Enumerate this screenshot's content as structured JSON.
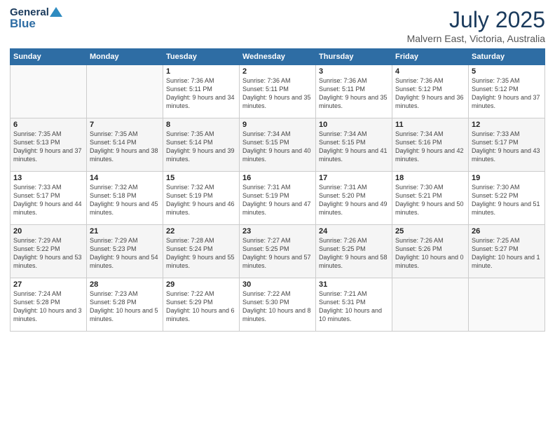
{
  "header": {
    "logo_general": "General",
    "logo_blue": "Blue",
    "month_year": "July 2025",
    "location": "Malvern East, Victoria, Australia"
  },
  "days_of_week": [
    "Sunday",
    "Monday",
    "Tuesday",
    "Wednesday",
    "Thursday",
    "Friday",
    "Saturday"
  ],
  "weeks": [
    [
      {
        "day": "",
        "empty": true
      },
      {
        "day": "",
        "empty": true
      },
      {
        "day": "1",
        "sunrise": "Sunrise: 7:36 AM",
        "sunset": "Sunset: 5:11 PM",
        "daylight": "Daylight: 9 hours and 34 minutes."
      },
      {
        "day": "2",
        "sunrise": "Sunrise: 7:36 AM",
        "sunset": "Sunset: 5:11 PM",
        "daylight": "Daylight: 9 hours and 35 minutes."
      },
      {
        "day": "3",
        "sunrise": "Sunrise: 7:36 AM",
        "sunset": "Sunset: 5:11 PM",
        "daylight": "Daylight: 9 hours and 35 minutes."
      },
      {
        "day": "4",
        "sunrise": "Sunrise: 7:36 AM",
        "sunset": "Sunset: 5:12 PM",
        "daylight": "Daylight: 9 hours and 36 minutes."
      },
      {
        "day": "5",
        "sunrise": "Sunrise: 7:35 AM",
        "sunset": "Sunset: 5:12 PM",
        "daylight": "Daylight: 9 hours and 37 minutes."
      }
    ],
    [
      {
        "day": "6",
        "sunrise": "Sunrise: 7:35 AM",
        "sunset": "Sunset: 5:13 PM",
        "daylight": "Daylight: 9 hours and 37 minutes."
      },
      {
        "day": "7",
        "sunrise": "Sunrise: 7:35 AM",
        "sunset": "Sunset: 5:14 PM",
        "daylight": "Daylight: 9 hours and 38 minutes."
      },
      {
        "day": "8",
        "sunrise": "Sunrise: 7:35 AM",
        "sunset": "Sunset: 5:14 PM",
        "daylight": "Daylight: 9 hours and 39 minutes."
      },
      {
        "day": "9",
        "sunrise": "Sunrise: 7:34 AM",
        "sunset": "Sunset: 5:15 PM",
        "daylight": "Daylight: 9 hours and 40 minutes."
      },
      {
        "day": "10",
        "sunrise": "Sunrise: 7:34 AM",
        "sunset": "Sunset: 5:15 PM",
        "daylight": "Daylight: 9 hours and 41 minutes."
      },
      {
        "day": "11",
        "sunrise": "Sunrise: 7:34 AM",
        "sunset": "Sunset: 5:16 PM",
        "daylight": "Daylight: 9 hours and 42 minutes."
      },
      {
        "day": "12",
        "sunrise": "Sunrise: 7:33 AM",
        "sunset": "Sunset: 5:17 PM",
        "daylight": "Daylight: 9 hours and 43 minutes."
      }
    ],
    [
      {
        "day": "13",
        "sunrise": "Sunrise: 7:33 AM",
        "sunset": "Sunset: 5:17 PM",
        "daylight": "Daylight: 9 hours and 44 minutes."
      },
      {
        "day": "14",
        "sunrise": "Sunrise: 7:32 AM",
        "sunset": "Sunset: 5:18 PM",
        "daylight": "Daylight: 9 hours and 45 minutes."
      },
      {
        "day": "15",
        "sunrise": "Sunrise: 7:32 AM",
        "sunset": "Sunset: 5:19 PM",
        "daylight": "Daylight: 9 hours and 46 minutes."
      },
      {
        "day": "16",
        "sunrise": "Sunrise: 7:31 AM",
        "sunset": "Sunset: 5:19 PM",
        "daylight": "Daylight: 9 hours and 47 minutes."
      },
      {
        "day": "17",
        "sunrise": "Sunrise: 7:31 AM",
        "sunset": "Sunset: 5:20 PM",
        "daylight": "Daylight: 9 hours and 49 minutes."
      },
      {
        "day": "18",
        "sunrise": "Sunrise: 7:30 AM",
        "sunset": "Sunset: 5:21 PM",
        "daylight": "Daylight: 9 hours and 50 minutes."
      },
      {
        "day": "19",
        "sunrise": "Sunrise: 7:30 AM",
        "sunset": "Sunset: 5:22 PM",
        "daylight": "Daylight: 9 hours and 51 minutes."
      }
    ],
    [
      {
        "day": "20",
        "sunrise": "Sunrise: 7:29 AM",
        "sunset": "Sunset: 5:22 PM",
        "daylight": "Daylight: 9 hours and 53 minutes."
      },
      {
        "day": "21",
        "sunrise": "Sunrise: 7:29 AM",
        "sunset": "Sunset: 5:23 PM",
        "daylight": "Daylight: 9 hours and 54 minutes."
      },
      {
        "day": "22",
        "sunrise": "Sunrise: 7:28 AM",
        "sunset": "Sunset: 5:24 PM",
        "daylight": "Daylight: 9 hours and 55 minutes."
      },
      {
        "day": "23",
        "sunrise": "Sunrise: 7:27 AM",
        "sunset": "Sunset: 5:25 PM",
        "daylight": "Daylight: 9 hours and 57 minutes."
      },
      {
        "day": "24",
        "sunrise": "Sunrise: 7:26 AM",
        "sunset": "Sunset: 5:25 PM",
        "daylight": "Daylight: 9 hours and 58 minutes."
      },
      {
        "day": "25",
        "sunrise": "Sunrise: 7:26 AM",
        "sunset": "Sunset: 5:26 PM",
        "daylight": "Daylight: 10 hours and 0 minutes."
      },
      {
        "day": "26",
        "sunrise": "Sunrise: 7:25 AM",
        "sunset": "Sunset: 5:27 PM",
        "daylight": "Daylight: 10 hours and 1 minute."
      }
    ],
    [
      {
        "day": "27",
        "sunrise": "Sunrise: 7:24 AM",
        "sunset": "Sunset: 5:28 PM",
        "daylight": "Daylight: 10 hours and 3 minutes."
      },
      {
        "day": "28",
        "sunrise": "Sunrise: 7:23 AM",
        "sunset": "Sunset: 5:28 PM",
        "daylight": "Daylight: 10 hours and 5 minutes."
      },
      {
        "day": "29",
        "sunrise": "Sunrise: 7:22 AM",
        "sunset": "Sunset: 5:29 PM",
        "daylight": "Daylight: 10 hours and 6 minutes."
      },
      {
        "day": "30",
        "sunrise": "Sunrise: 7:22 AM",
        "sunset": "Sunset: 5:30 PM",
        "daylight": "Daylight: 10 hours and 8 minutes."
      },
      {
        "day": "31",
        "sunrise": "Sunrise: 7:21 AM",
        "sunset": "Sunset: 5:31 PM",
        "daylight": "Daylight: 10 hours and 10 minutes."
      },
      {
        "day": "",
        "empty": true
      },
      {
        "day": "",
        "empty": true
      }
    ]
  ]
}
